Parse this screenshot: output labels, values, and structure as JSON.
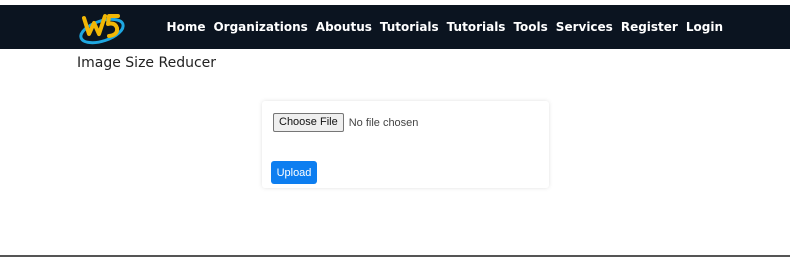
{
  "header": {
    "logo_alt": "W3 logo",
    "nav": [
      {
        "label": "Home"
      },
      {
        "label": "Organizations"
      },
      {
        "label": "Aboutus"
      },
      {
        "label": "Tutorials"
      },
      {
        "label": "Tutorials"
      },
      {
        "label": "Tools"
      },
      {
        "label": "Services"
      },
      {
        "label": "Register"
      },
      {
        "label": "Login"
      }
    ]
  },
  "page": {
    "title": "Image Size Reducer"
  },
  "form": {
    "choose_label": "Choose File",
    "file_status": "No file chosen",
    "upload_label": "Upload"
  },
  "colors": {
    "navbar_bg": "#0b1420",
    "primary_button": "#0d7ef0",
    "logo_blue": "#1ea7e1",
    "logo_yellow": "#f2b705"
  }
}
